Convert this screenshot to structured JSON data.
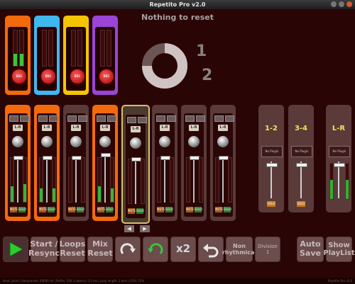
{
  "window": {
    "title": "Repetito Pro v2.0"
  },
  "header": {
    "reset_text": "Nothing to reset"
  },
  "cycle": {
    "numerator": "1",
    "denominator": "2",
    "progress": 0.75
  },
  "colors": {
    "orange": "#f36a0c",
    "light_blue": "#3fb8f0",
    "yellow": "#f5c400",
    "purple": "#9a45d8",
    "meter_green": "#3bc43b",
    "bus_label_yellow": "#f3e35a"
  },
  "top_channels": [
    {
      "color": "#f36a0c",
      "level": 0.35,
      "rec_label": "REC"
    },
    {
      "color": "#3fb8f0",
      "level": 0.0,
      "rec_label": "REC"
    },
    {
      "color": "#f5c400",
      "level": 0.0,
      "rec_label": "REC"
    },
    {
      "color": "#9a45d8",
      "level": 0.0,
      "rec_label": "REC"
    }
  ],
  "channel_strips": [
    {
      "style": "orange",
      "lr_label": "L-R",
      "mute_label": "MUTE",
      "solo_label": "SOLO",
      "meter_left": 0.35,
      "meter_right": 0.4,
      "fader": 0.18
    },
    {
      "style": "orange",
      "lr_label": "L-R",
      "mute_label": "MUTE",
      "solo_label": "SOLO",
      "meter_left": 0.3,
      "meter_right": 0.3,
      "fader": 0.18
    },
    {
      "style": "plain",
      "lr_label": "L-R",
      "mute_label": "MUTE",
      "solo_label": "SOLO",
      "meter_left": 0.0,
      "meter_right": 0.0,
      "fader": 0.18
    },
    {
      "style": "orange",
      "lr_label": "L-R",
      "mute_label": "MUTE",
      "solo_label": "SOLO",
      "meter_left": 0.35,
      "meter_right": 0.3,
      "fader": 0.25
    },
    {
      "style": "selected",
      "lr_label": "L-R",
      "mute_label": "MUTE",
      "solo_label": "SOLO",
      "meter_left": 0.0,
      "meter_right": 0.0,
      "fader": 0.18
    },
    {
      "style": "plain",
      "lr_label": "L-R",
      "mute_label": "MUTE",
      "solo_label": "SOLO",
      "meter_left": 0.0,
      "meter_right": 0.0,
      "fader": 0.18
    },
    {
      "style": "plain",
      "lr_label": "L-R",
      "mute_label": "MUTE",
      "solo_label": "SOLO",
      "meter_left": 0.0,
      "meter_right": 0.0,
      "fader": 0.18
    },
    {
      "style": "plain",
      "lr_label": "L-R",
      "mute_label": "MUTE",
      "solo_label": "SOLO",
      "meter_left": 0.0,
      "meter_right": 0.0,
      "fader": 0.18
    }
  ],
  "selection_arrows": {
    "left": "◀",
    "right": "▶"
  },
  "buses": [
    {
      "label": "1-2",
      "plugin": "No Plugin",
      "solo_label": "SOLO",
      "meter": 0.0
    },
    {
      "label": "3-4",
      "plugin": "No Plugin",
      "solo_label": "SOLO",
      "meter": 0.0
    },
    {
      "label": "L-R",
      "plugin": "No Plugin",
      "solo_label": "",
      "meter": 0.55
    }
  ],
  "toolbar": {
    "start_resync": "Start / Resync",
    "loops_reset": "Loops Reset",
    "mix_reset": "Mix Reset",
    "x2": "x2",
    "non_rhythmical": "Non rhythmical",
    "division": "Division",
    "division_value": "1",
    "auto_save": "Auto Save",
    "show_playlist": "Show PlayList"
  },
  "status": {
    "left": "Host: jackd | Samplerate: 48000 Hz | Buffer: 256 | Latency: 5.3 ms | Loop length: 2 bars | CPU: 12%",
    "right": "Repetito Pro v2.0"
  }
}
